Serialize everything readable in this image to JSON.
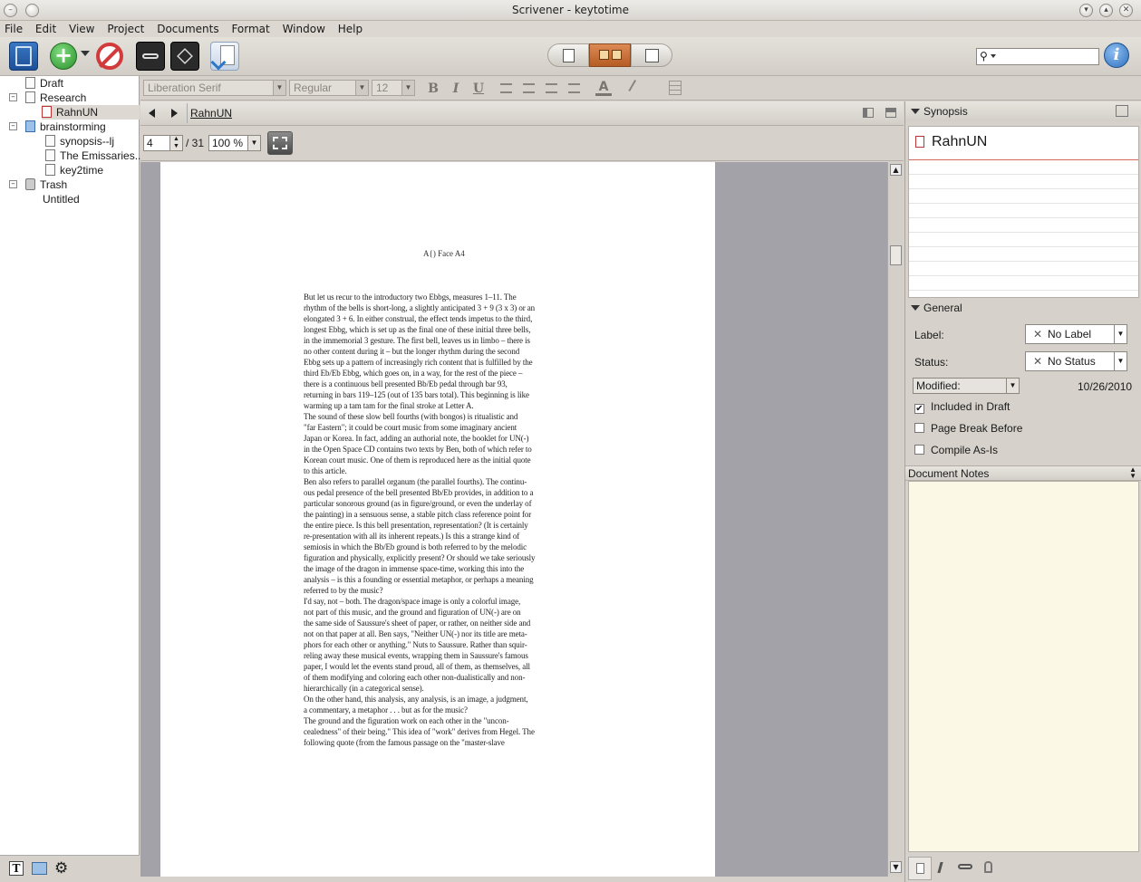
{
  "window": {
    "title": "Scrivener - keytotime",
    "btn_minimize": "▾",
    "btn_maximize": "▴",
    "btn_close": "✕",
    "btn_app": "–"
  },
  "menu": [
    "File",
    "Edit",
    "View",
    "Project",
    "Documents",
    "Format",
    "Window",
    "Help"
  ],
  "format_bar": {
    "font": "Liberation Serif",
    "style": "Regular",
    "size": "12",
    "bold": "B",
    "italic": "I",
    "underline": "U"
  },
  "binder": {
    "items": [
      {
        "label": "Draft"
      },
      {
        "label": "Research"
      },
      {
        "label": "RahnUN"
      },
      {
        "label": "brainstorming"
      },
      {
        "label": "synopsis--lj"
      },
      {
        "label": "The Emissaries..."
      },
      {
        "label": "key2time"
      },
      {
        "label": "Trash"
      },
      {
        "label": "Untitled"
      }
    ]
  },
  "editor": {
    "doc_title": "RahnUN",
    "page_number": "4",
    "page_total": "/ 31",
    "zoom": "100 %"
  },
  "pdf": {
    "running_head": "A{) Face A4",
    "lines": [
      "But let us recur to the introductory two Ebbgs, measures 1–11. The",
      "rhythm of the bells is short-long, a slightly anticipated 3 + 9 (3 x 3) or an",
      "elongated 3 + 6. In either construal, the effect tends impetus to the third,",
      "longest Ebbg, which is set up as the final one of these initial three bells,",
      "in the immemorial 3 gesture. The first bell, leaves us in limbo – there is",
      "no other content during it – but the longer rhythm during the second",
      "Ebbg sets up a pattern of increasingly rich content that is fulfilled by the",
      "third Eb/Eb Ebbg, which goes on, in a way, for the rest of the piece –",
      "there is a continuous bell presented Bb/Eb pedal through bar 93,",
      "returning in bars 119–125 (out of 135 bars total). This beginning is like",
      "warming up a tam tam for the final stroke at Letter A.",
      "The sound of these slow bell fourths (with bongos) is ritualistic and",
      "\"far Eastern\"; it could be court music from some imaginary ancient",
      "Japan or Korea. In fact, adding an authorial note, the booklet for UN(-)",
      "in the Open Space CD contains two texts by Ben, both of which refer to",
      "Korean court music. One of them is reproduced here as the initial quote",
      "to this article.",
      "Ben also refers to parallel organum (the parallel fourths). The continu-",
      "ous pedal presence of the bell presented Bb/Eb provides, in addition to a",
      "particular sonorous ground (as in figure/ground, or even the underlay of",
      "the painting) in a sensuous sense, a stable pitch class reference point for",
      "the entire piece. Is this bell presentation, representation? (It is certainly",
      "re-presentation with all its inherent repeats.) Is this a strange kind of",
      "semiosis in which the Bb/Eb ground is both referred to by the melodic",
      "figuration and physically, explicitly present? Or should we take seriously",
      "the image of the dragon in immense space-time, working this into the",
      "analysis – is this a founding or essential metaphor, or perhaps a meaning",
      "referred to by the music?",
      "I'd say, not – both. The dragon/space image is only a colorful image,",
      "not part of this music, and the ground and figuration of UN(-) are on",
      "the same side of Saussure's sheet of paper, or rather, on neither side and",
      "not on that paper at all. Ben says, \"Neither UN(-) nor its title are meta-",
      "phors for each other or anything.\" Nuts to Saussure. Rather than squir-",
      "reling away these musical events, wrapping them in Saussure's famous",
      "paper, I would let the events stand proud, all of them, as themselves, all",
      "of them modifying and coloring each other non-dualistically and non-",
      "hierarchically (in a categorical sense).",
      "On the other hand, this analysis, any analysis, is an image, a judgment,",
      "a commentary, a metaphor . . . but as for the music?",
      "The ground and the figuration work on each other in the \"uncon-",
      "cealedness\" of their being.\" This idea of \"work\" derives from Hegel. The",
      "following quote (from the famous passage on the \"master-slave"
    ]
  },
  "inspector": {
    "synopsis_header": "Synopsis",
    "synopsis_title": "RahnUN",
    "general_header": "General",
    "label_caption": "Label:",
    "label_value": "No Label",
    "status_caption": "Status:",
    "status_value": "No Status",
    "modified_caption": "Modified:",
    "modified_date": "10/26/2010",
    "included_in_draft": "Included in Draft",
    "page_break_before": "Page Break Before",
    "compile_as_is": "Compile As-Is",
    "document_notes": "Document Notes",
    "check_mark": "✔"
  },
  "colors": {
    "accent_orange": "#c9703a",
    "add_green": "#3aa13a",
    "stop_red": "#d23b3b",
    "info_blue": "#3d86d6"
  }
}
